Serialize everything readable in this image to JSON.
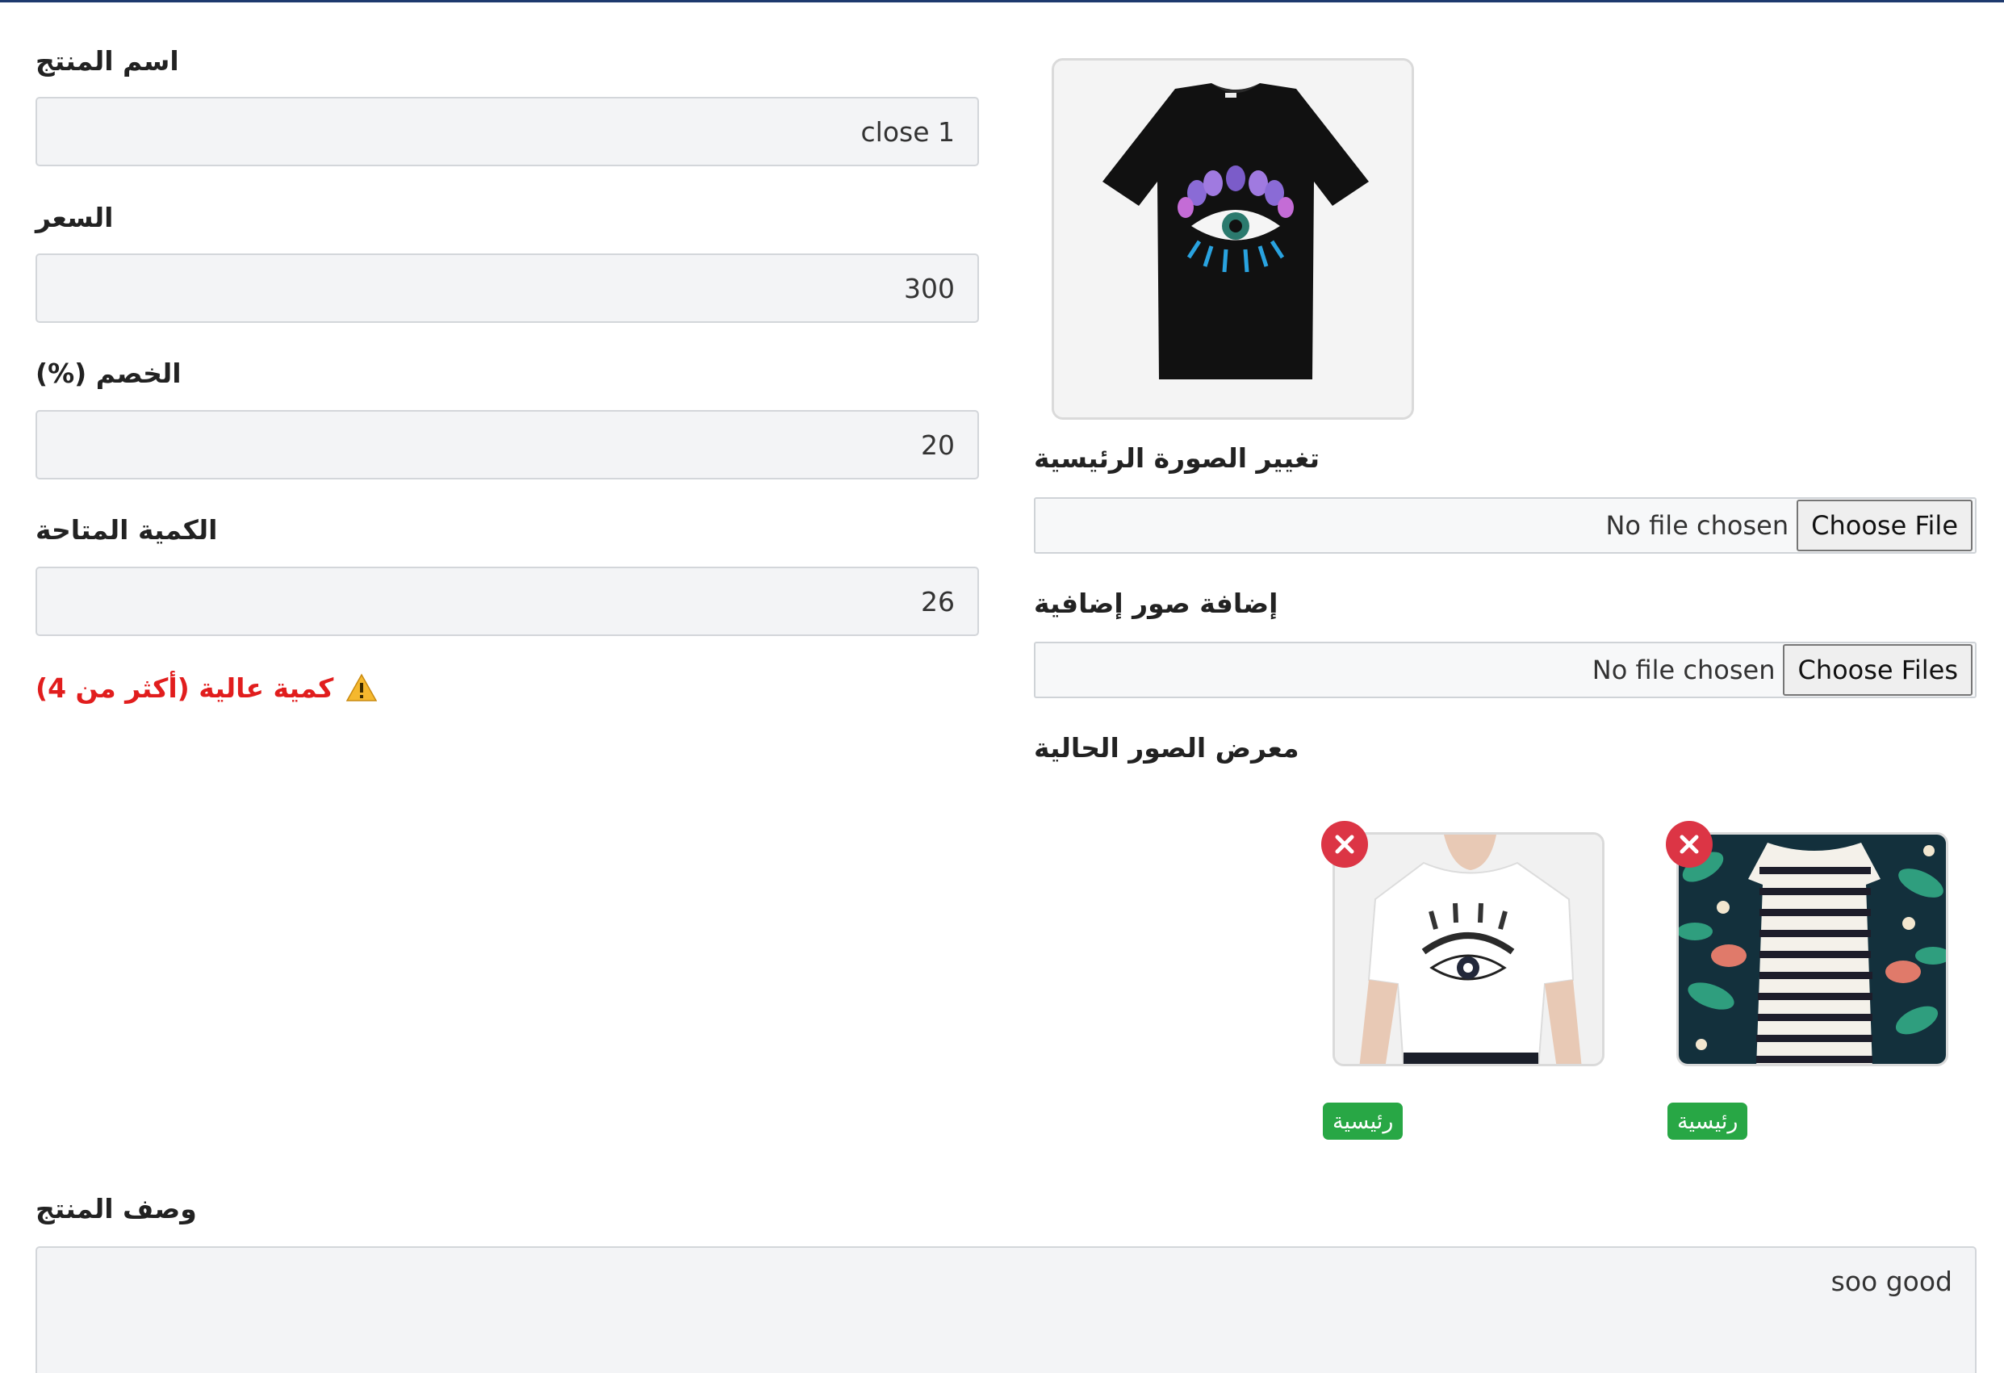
{
  "form": {
    "name": {
      "label": "اسم المنتج",
      "value": "close 1"
    },
    "price": {
      "label": "السعر",
      "value": "300"
    },
    "discount": {
      "label": "الخصم (%)",
      "value": "20"
    },
    "quantity": {
      "label": "الكمية المتاحة",
      "value": "26"
    },
    "warning": {
      "text": "كمية عالية (أكثر من 4)",
      "icon": "warning-icon"
    },
    "description": {
      "label": "وصف المنتج",
      "value": "soo good"
    }
  },
  "images": {
    "change_main_label": "تغيير الصورة الرئيسية",
    "main_file_status": "No file chosen",
    "main_file_button": "Choose File",
    "add_extra_label": "إضافة صور إضافية",
    "extra_file_status": "No file chosen",
    "extra_file_button": "Choose Files",
    "gallery_label": "معرض الصور الحالية",
    "gallery": [
      {
        "badge": "رئيسية",
        "icon": "close-icon"
      },
      {
        "badge": "رئيسية",
        "icon": "close-icon"
      }
    ]
  },
  "colors": {
    "warning": "#e11d1d",
    "badge": "#28a745",
    "remove": "#dc3545",
    "input_bg": "#f3f4f6"
  }
}
